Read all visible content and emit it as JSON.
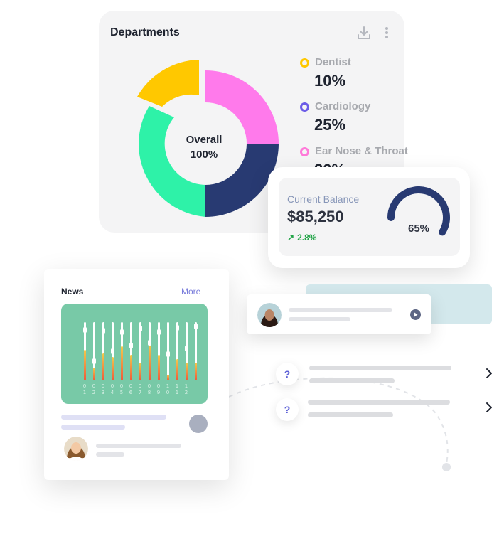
{
  "departments": {
    "title": "Departments",
    "icons": {
      "download": "download-icon",
      "menu": "kebab-menu-icon"
    },
    "center": {
      "line1": "Overall",
      "line2": "100%"
    },
    "legend": [
      {
        "label": "Dentist",
        "percent": "10%",
        "color": "#ffc800"
      },
      {
        "label": "Cardiology",
        "percent": "25%",
        "color": "#6c5ce7"
      },
      {
        "label": "Ear Nose & Throat",
        "percent": "20%",
        "color": "#ff7ad9"
      }
    ],
    "segments": [
      {
        "color": "#ff7aeb",
        "value": 25
      },
      {
        "color": "#283a72",
        "value": 25
      },
      {
        "color": "#2ef2a8",
        "value": 36
      },
      {
        "color": "#ffc800",
        "value": 14
      }
    ]
  },
  "balance": {
    "label": "Current Balance",
    "amount": "$85,250",
    "change": "2.8%",
    "change_icon": "arrow-up-right-icon",
    "gauge_value": 65,
    "gauge_label": "65%",
    "colors": {
      "gauge": "#283a72",
      "positive": "#22a447"
    }
  },
  "news": {
    "title": "News",
    "more_label": "More",
    "chart_bg": "#78c9a7",
    "bars": [
      {
        "value": 0.52,
        "knob": 0.08
      },
      {
        "value": 0.22,
        "knob": 0.62
      },
      {
        "value": 0.46,
        "knob": 0.1
      },
      {
        "value": 0.4,
        "knob": 0.45
      },
      {
        "value": 0.58,
        "knob": 0.12
      },
      {
        "value": 0.44,
        "knob": 0.35
      },
      {
        "value": 0.3,
        "knob": 0.06
      },
      {
        "value": 0.62,
        "knob": 0.3
      },
      {
        "value": 0.44,
        "knob": 0.12
      },
      {
        "value": 0.1,
        "knob": 0.5
      },
      {
        "value": 0.36,
        "knob": 0.05
      },
      {
        "value": 0.3,
        "knob": 0.4
      },
      {
        "value": 0.3,
        "knob": 0.02
      }
    ],
    "tick_labels": [
      [
        "0",
        "1"
      ],
      [
        "0",
        "2"
      ],
      [
        "0",
        "3"
      ],
      [
        "0",
        "4"
      ],
      [
        "0",
        "5"
      ],
      [
        "0",
        "6"
      ],
      [
        "0",
        "7"
      ],
      [
        "0",
        "8"
      ],
      [
        "0",
        "9"
      ],
      [
        "1",
        "0"
      ],
      [
        "1",
        "1"
      ],
      [
        "1",
        "2"
      ]
    ]
  },
  "chat": {
    "icon": "play-icon"
  },
  "faq": {
    "question_mark": "?",
    "chevron_icon": "chevron-right-icon"
  }
}
